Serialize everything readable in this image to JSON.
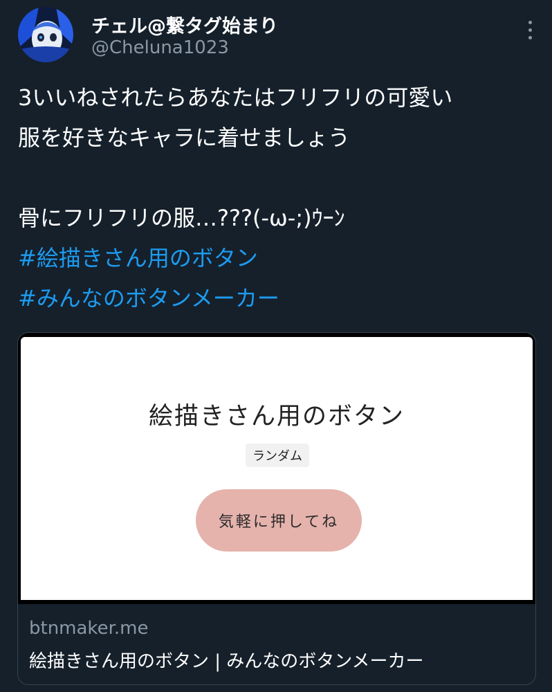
{
  "tweet": {
    "author": {
      "display_name": "チェル@繋タグ始まり",
      "handle": "@Cheluna1023"
    },
    "more_icon": "more-vertical-icon",
    "body_lines": [
      "3いいねされたらあなたはフリフリの可愛い",
      "服を好きなキャラに着せましょう",
      "",
      "骨にフリフリの服…???(-ω-;)ｳｰﾝ"
    ],
    "hashtags": [
      "#絵描きさん用のボタン",
      "#みんなのボタンメーカー"
    ]
  },
  "link_card": {
    "preview": {
      "title": "絵描きさん用のボタン",
      "tag": "ランダム",
      "button_label": "気軽に押してね"
    },
    "domain": "btnmaker.me",
    "title": "絵描きさん用のボタン | みんなのボタンメーカー"
  },
  "colors": {
    "background": "#15202b",
    "text": "#ffffff",
    "secondary_text": "#8b98a5",
    "hashtag": "#1d9bf0",
    "border": "#38444d",
    "preview_button": "#e5b3ac"
  }
}
